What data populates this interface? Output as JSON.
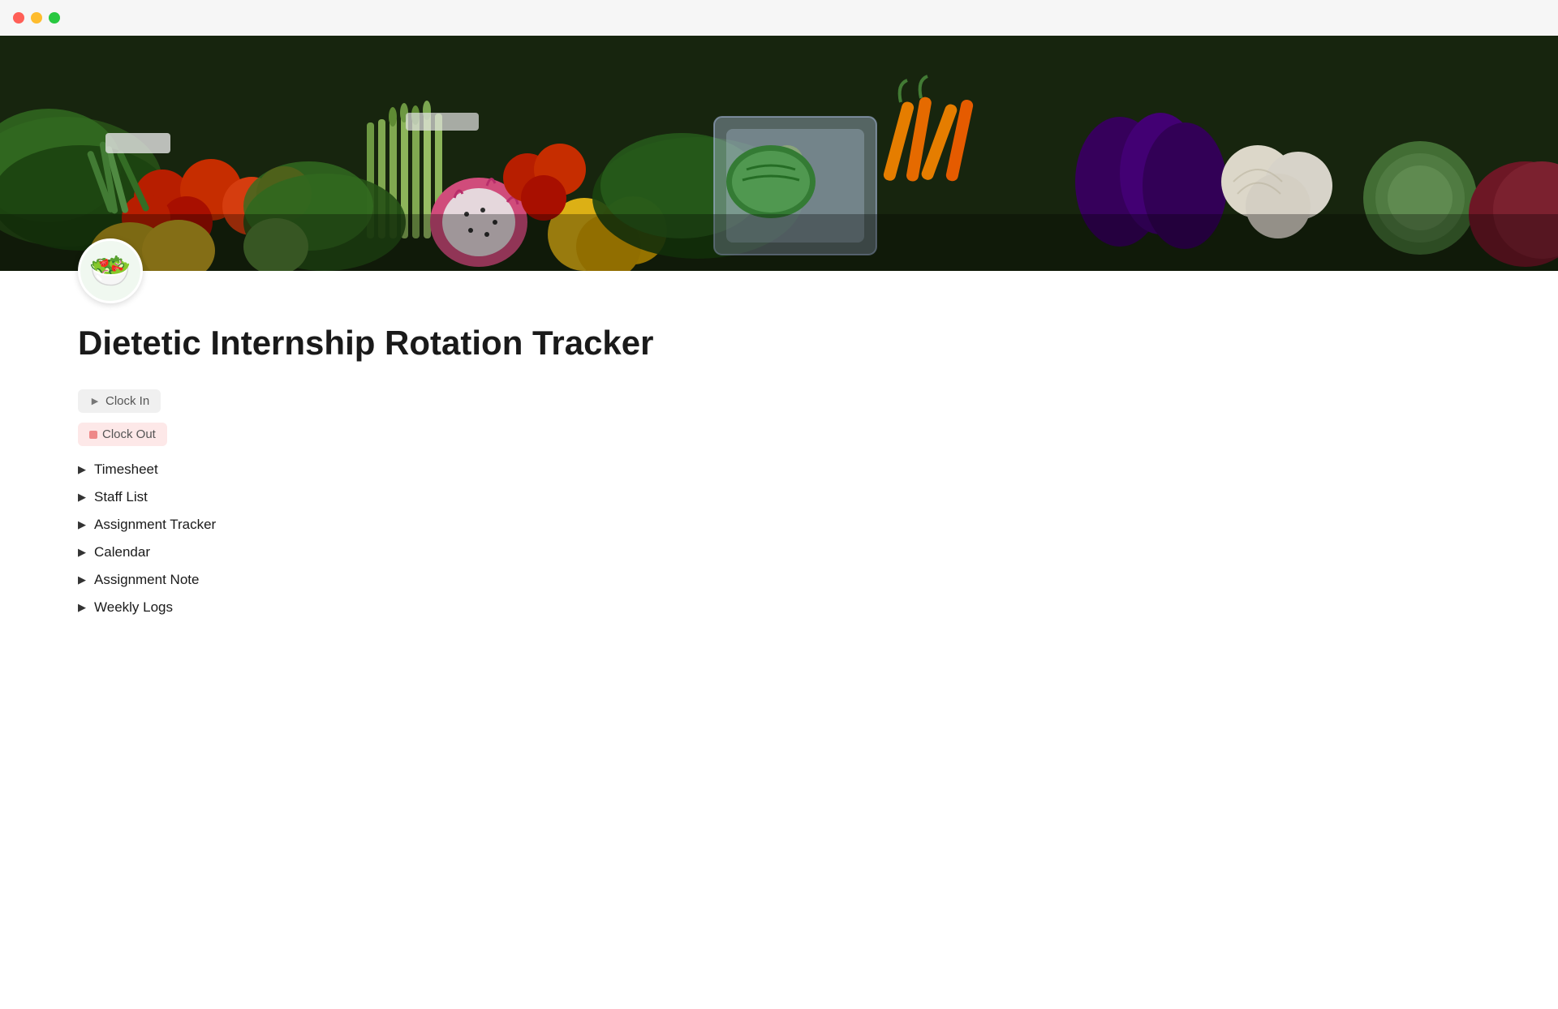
{
  "titlebar": {
    "traffic_close": "close",
    "traffic_minimize": "minimize",
    "traffic_maximize": "maximize"
  },
  "page": {
    "icon": "🥗",
    "title": "Dietetic Internship Rotation Tracker"
  },
  "actions": [
    {
      "id": "clock-in",
      "label": "Clock In",
      "type": "clock-in",
      "icon": "▶"
    },
    {
      "id": "clock-out",
      "label": "Clock Out",
      "type": "clock-out",
      "icon": "■"
    }
  ],
  "list_items": [
    {
      "id": "timesheet",
      "label": "Timesheet"
    },
    {
      "id": "staff-list",
      "label": "Staff List"
    },
    {
      "id": "assignment-tracker",
      "label": "Assignment Tracker"
    },
    {
      "id": "calendar",
      "label": "Calendar"
    },
    {
      "id": "assignment-note",
      "label": "Assignment Note"
    },
    {
      "id": "weekly-logs",
      "label": "Weekly Logs"
    }
  ]
}
